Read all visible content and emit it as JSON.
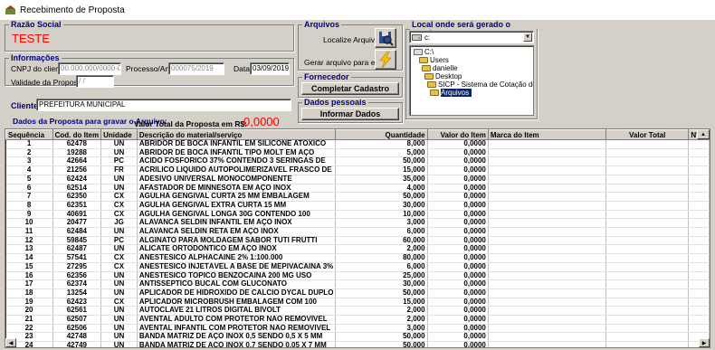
{
  "window": {
    "title": "Recebimento de Proposta"
  },
  "razao_social": {
    "legend": "Razão Social",
    "value": "TESTE"
  },
  "informacoes": {
    "legend": "Informações",
    "cnpj_label": "CNPJ do cliente",
    "cnpj_value": "00.000.000/0000-00",
    "processo_label": "Processo/Ano",
    "processo_value": "000075/2019",
    "data_label": "Data",
    "data_value": "03/09/2019",
    "validade_label": "Validade da Proposta",
    "validade_value": "/ /"
  },
  "cliente": {
    "label": "Cliente",
    "value": "PREFEITURA MUNICIPAL"
  },
  "arquivos": {
    "legend": "Arquivos",
    "localize_label": "Localize Arquivo",
    "gerar_label": "Gerar arquivo para enviar"
  },
  "fornecedor": {
    "legend": "Fornecedor",
    "button": "Completar Cadastro"
  },
  "dados_pessoais": {
    "legend": "Dados pessoais",
    "button": "Informar Dados"
  },
  "local": {
    "legend": "Local onde será gerado o arquivo",
    "drive": "c:",
    "tree": [
      "C:\\",
      "Users",
      "danielle",
      "Desktop",
      "SICP - Sistema de Cotação de Preço - F",
      "Arquivos"
    ]
  },
  "dados_proposta": {
    "label": "Dados da Proposta para gravar o Arquivo:",
    "total_label": "Valor Total da Proposta em R$:",
    "total_value": "0,0000"
  },
  "table": {
    "headers": [
      "Sequência",
      "Cod. do Item",
      "Unidade",
      "Descrição do material/serviço",
      "Quantidade",
      "Valor do Item",
      "Marca do Item",
      "Valor Total",
      "N°"
    ],
    "rows": [
      [
        "1",
        "62478",
        "UN",
        "ABRIDOR DE BOCA INFANTIL EM SILICONE ATÓXICO",
        "8,000",
        "0,0000"
      ],
      [
        "2",
        "19288",
        "UN",
        "ABRIDOR DE BOCA INFANTIL TIPO MOLT EM AÇO",
        "5,000",
        "0,0000"
      ],
      [
        "3",
        "42664",
        "PC",
        "ÁCIDO FOSFÓRICO 37% CONTENDO 3 SERINGAS DE",
        "50,000",
        "0,0000"
      ],
      [
        "4",
        "21256",
        "FR",
        "ACRÍLICO LÍQUIDO AUTOPOLIMERIZÁVEL FRASCO DE",
        "15,000",
        "0,0000"
      ],
      [
        "5",
        "62424",
        "UN",
        "ADESIVO UNIVERSAL MONOCOMPONENTE",
        "35,000",
        "0,0000"
      ],
      [
        "6",
        "62514",
        "UN",
        "AFASTADOR DE MINNESOTA EM AÇO INOX",
        "4,000",
        "0,0000"
      ],
      [
        "7",
        "62350",
        "CX",
        "AGULHA GENGIVAL CURTA 25 MM EMBALAGEM",
        "50,000",
        "0,0000"
      ],
      [
        "8",
        "62351",
        "CX",
        "AGULHA GENGIVAL EXTRA CURTA 15 MM",
        "30,000",
        "0,0000"
      ],
      [
        "9",
        "40691",
        "CX",
        "AGULHA GENGIVAL LONGA 30G CONTENDO 100",
        "10,000",
        "0,0000"
      ],
      [
        "10",
        "20477",
        "JG",
        "ALAVANCA SELDIN INFANTIL EM AÇO INOX",
        "3,000",
        "0,0000"
      ],
      [
        "11",
        "62484",
        "UN",
        "ALAVANCA SELDIN RETA EM AÇO INOX",
        "6,000",
        "0,0000"
      ],
      [
        "12",
        "59845",
        "PC",
        "ALGINATO PARA MOLDAGEM SABOR TUTI FRUTTI",
        "60,000",
        "0,0000"
      ],
      [
        "13",
        "62487",
        "UN",
        "ALICATE ORTODÔNTICO EM AÇO INOX",
        "2,000",
        "0,0000"
      ],
      [
        "14",
        "57541",
        "CX",
        "ANESTÉSICO ALPHACAINE 2% 1:100.000",
        "80,000",
        "0,0000"
      ],
      [
        "15",
        "27295",
        "CX",
        "ANESTÉSICO INJETÁVEL A BASE DE MEPIVACAÍNA 3%",
        "6,000",
        "0,0000"
      ],
      [
        "16",
        "62356",
        "UN",
        "ANESTÉSICO TÓPICO BENZOCAÍNA 200 MG USO",
        "25,000",
        "0,0000"
      ],
      [
        "17",
        "62374",
        "UN",
        "ANTISSÉPTICO BUCAL COM GLUCONATO",
        "30,000",
        "0,0000"
      ],
      [
        "18",
        "13254",
        "UN",
        "APLICADOR DE HIDRÓXIDO DE CÁLCIO DYCAL DUPLO",
        "50,000",
        "0,0000"
      ],
      [
        "19",
        "62423",
        "CX",
        "APLICADOR MICROBRUSH EMBALAGEM COM 100",
        "15,000",
        "0,0000"
      ],
      [
        "20",
        "62561",
        "UN",
        "AUTOCLAVE 21 LITROS DIGITAL BIVOLT",
        "2,000",
        "0,0000"
      ],
      [
        "21",
        "62507",
        "UN",
        "AVENTAL ADULTO COM PROTETOR NÃO REMOVÍVEL",
        "2,000",
        "0,0000"
      ],
      [
        "22",
        "62506",
        "UN",
        "AVENTAL INFANTIL COM PROTETOR NÃO REMOVÍVEL",
        "3,000",
        "0,0000"
      ],
      [
        "23",
        "42748",
        "UN",
        "BANDA MATRIZ DE AÇO INOX 0,5 SENDO 0,5 X 5 MM",
        "50,000",
        "0,0000"
      ],
      [
        "24",
        "42749",
        "UN",
        "BANDA MATRIZ DE AÇO INOX 0,7 SENDO 0,05 X 7 MM",
        "50,000",
        "0,0000"
      ]
    ]
  },
  "colors": {
    "legend": "#000080",
    "accent_red": "#ff0000",
    "selection": "#0a246a"
  }
}
